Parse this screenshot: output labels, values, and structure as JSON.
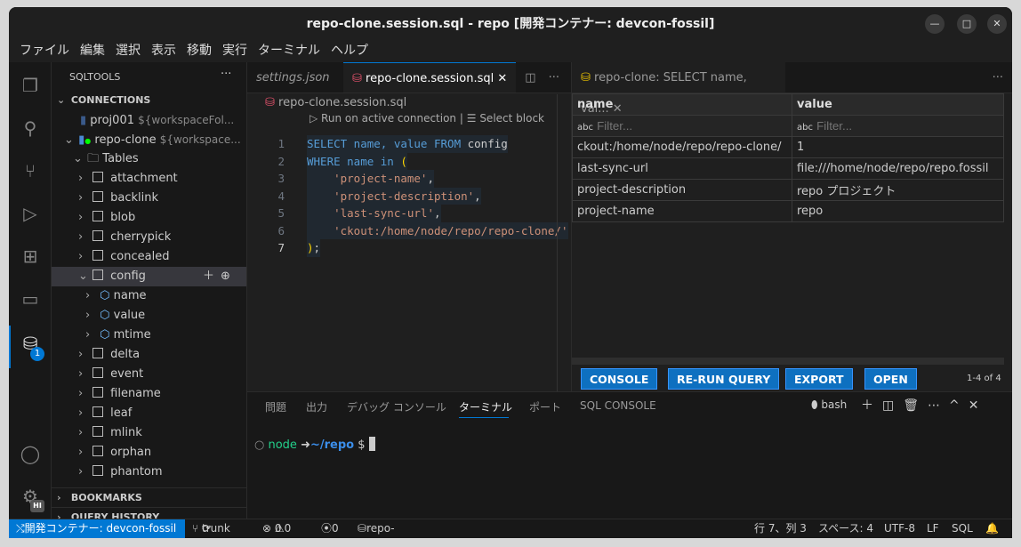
{
  "window": {
    "title": "repo-clone.session.sql - repo [開発コンテナー: devcon-fossil]"
  },
  "menu": [
    "ファイル",
    "編集",
    "選択",
    "表示",
    "移動",
    "実行",
    "ターミナル",
    "ヘルプ"
  ],
  "sidebar": {
    "title": "SQLTOOLS",
    "more": "···",
    "connections_label": "CONNECTIONS",
    "connections": [
      {
        "name": "proj001",
        "hint": "${workspaceFol..."
      },
      {
        "name": "repo-clone",
        "hint": "${workspace..."
      }
    ],
    "tables_label": "Tables",
    "tables_before": [
      "attachment",
      "backlink",
      "blob",
      "cherrypick",
      "concealed"
    ],
    "selected_table": "config",
    "columns": [
      "name",
      "value",
      "mtime"
    ],
    "tables_after": [
      "delta",
      "event",
      "filename",
      "leaf",
      "mlink",
      "orphan",
      "phantom"
    ],
    "bookmarks": "BOOKMARKS",
    "query_history": "QUERY HISTORY"
  },
  "activity": {
    "badge": "1",
    "account_badge": "HI"
  },
  "editor": {
    "tabs": [
      {
        "label": "settings.json"
      },
      {
        "label": "repo-clone.session.sql"
      }
    ],
    "breadcrumb": "repo-clone.session.sql",
    "codelens_run": "Run on active connection",
    "codelens_sep": "|",
    "codelens_select": "Select block",
    "lines": [
      "1",
      "2",
      "3",
      "4",
      "5",
      "6",
      "7"
    ]
  },
  "code": {
    "l1a": "SELECT name, value FROM",
    "l1b": " config",
    "l2a": "WHERE name in ",
    "l2b": "(",
    "l3": "    'project-name'",
    "l4": "    'project-description'",
    "l5": "    'last-sync-url'",
    "l6": "    'ckout:/home/node/repo/repo-clone/'",
    "l7a": ")",
    "l7b": ";",
    "comma": ","
  },
  "results": {
    "tab": "repo-clone: SELECT name, val...",
    "columns": [
      "name",
      "value"
    ],
    "filter_placeholder": "Filter...",
    "rows": [
      [
        "ckout:/home/node/repo/repo-clone/",
        "1"
      ],
      [
        "last-sync-url",
        "file:///home/node/repo/repo.fossil"
      ],
      [
        "project-description",
        "repo プロジェクト"
      ],
      [
        "project-name",
        "repo"
      ]
    ],
    "buttons": [
      "CONSOLE",
      "RE-RUN QUERY",
      "EXPORT",
      "OPEN"
    ],
    "count": "1-4 of 4"
  },
  "panel": {
    "tabs": [
      "問題",
      "出力",
      "デバッグ コンソール",
      "ターミナル",
      "ポート",
      "SQL CONSOLE"
    ],
    "active": "ターミナル",
    "shell": "bash",
    "prompt_user": "node",
    "prompt_arrow": "➜",
    "prompt_path": "~/repo",
    "prompt_sym": "$"
  },
  "status": {
    "remote": "開発コンテナー: devcon-fossil",
    "branch": "trunk",
    "errors": "0",
    "warnings": "0",
    "ports": "0",
    "connection": "repo-clone",
    "position": "行 7、列 3",
    "spaces": "スペース: 4",
    "encoding": "UTF-8",
    "eol": "LF",
    "language": "SQL"
  },
  "colors": {
    "accent": "#0078d4",
    "button": "#0e70c0",
    "keyword": "#569cd6",
    "string": "#ce9178",
    "prompt_user": "#23d18b",
    "prompt_path": "#3b8eea"
  }
}
